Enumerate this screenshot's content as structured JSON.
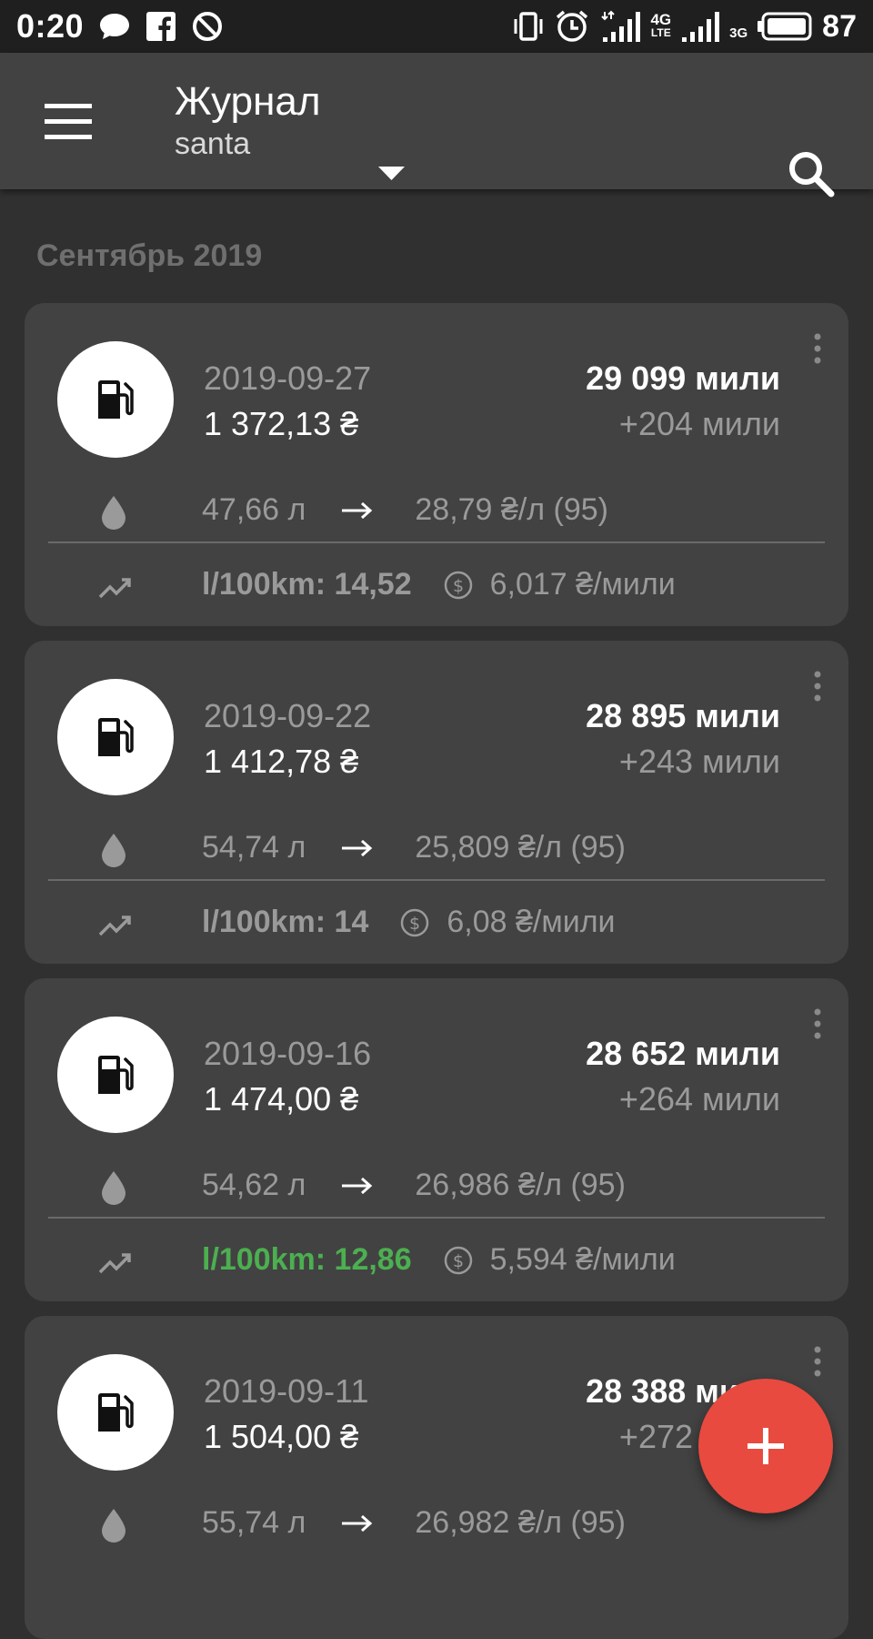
{
  "status_bar": {
    "time": "0:20",
    "network_4g": "4G",
    "network_lte": "LTE",
    "network_3g": "3G",
    "battery": "87"
  },
  "app_bar": {
    "title": "Журнал",
    "subtitle": "santa"
  },
  "month": "Сентябрь 2019",
  "entries": [
    {
      "date": "2019-09-27",
      "cost": "1 372,13 ₴",
      "odometer": "29 099 мили",
      "distance": "+204 мили",
      "volume": "47,66 л",
      "price": "28,79 ₴/л (95)",
      "consumption": "l/100km: 14,52",
      "cost_per_distance": "6,017 ₴/мили"
    },
    {
      "date": "2019-09-22",
      "cost": "1 412,78 ₴",
      "odometer": "28 895 мили",
      "distance": "+243 мили",
      "volume": "54,74 л",
      "price": "25,809 ₴/л (95)",
      "consumption": "l/100km: 14",
      "cost_per_distance": "6,08 ₴/мили"
    },
    {
      "date": "2019-09-16",
      "cost": "1 474,00 ₴",
      "odometer": "28 652 мили",
      "distance": "+264 мили",
      "volume": "54,62 л",
      "price": "26,986 ₴/л (95)",
      "consumption": "l/100km: 12,86",
      "cost_per_distance": "5,594 ₴/мили"
    },
    {
      "date": "2019-09-11",
      "cost": "1 504,00 ₴",
      "odometer": "28 388 мили",
      "distance": "+272 мили",
      "volume": "55,74 л",
      "price": "26,982 ₴/л (95)",
      "consumption": "",
      "cost_per_distance": ""
    }
  ],
  "colors": {
    "background": "#303030",
    "card": "#424242",
    "app_bar": "#424242",
    "fab": "#e84a3f",
    "good_consumption": "#4caf50"
  }
}
